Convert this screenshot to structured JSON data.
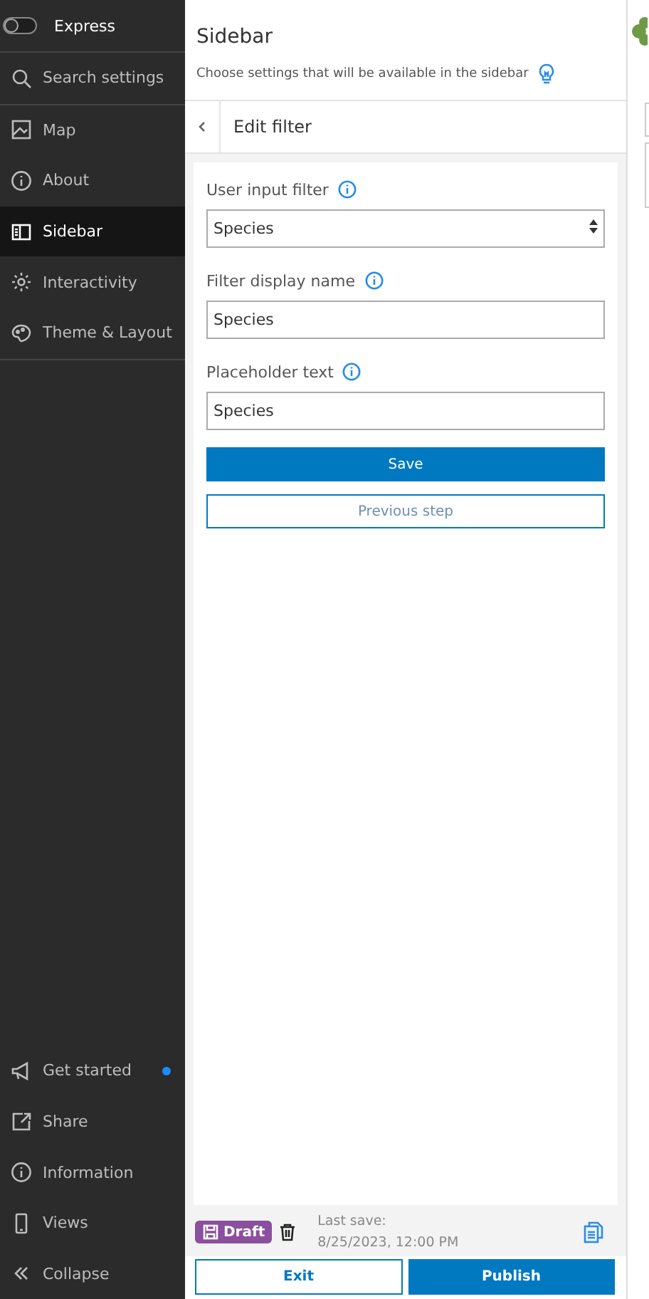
{
  "nav": {
    "toggle": {
      "label": "Express",
      "on": false
    },
    "items": [
      {
        "label": "Search settings",
        "selected": false
      },
      {
        "label": "Map",
        "selected": false
      },
      {
        "label": "About",
        "selected": false
      },
      {
        "label": "Sidebar",
        "selected": true
      },
      {
        "label": "Interactivity",
        "selected": false
      },
      {
        "label": "Theme & Layout",
        "selected": false
      }
    ],
    "bottom_items": [
      {
        "label": "Get started",
        "notification": true
      },
      {
        "label": "Share",
        "notification": false
      },
      {
        "label": "Information",
        "notification": false
      },
      {
        "label": "Views",
        "notification": false
      },
      {
        "label": "Collapse",
        "notification": false
      }
    ]
  },
  "panel": {
    "title": "Sidebar",
    "description": "Choose settings that will be available in the sidebar",
    "subheader": "Edit filter",
    "fields": [
      {
        "kind": "select",
        "label": "User input filter",
        "value": "Species"
      },
      {
        "kind": "text",
        "label": "Filter display name",
        "value": "Species"
      },
      {
        "kind": "text",
        "label": "Placeholder text",
        "value": "Species"
      }
    ],
    "buttons": [
      {
        "label": "Save",
        "kind": "primary"
      },
      {
        "label": "Previous step",
        "kind": "secondary"
      }
    ]
  },
  "footer": {
    "badge": "Draft",
    "last_save_label": "Last save:",
    "last_save_time": "8/25/2023, 12:00 PM",
    "buttons": [
      {
        "label": "Exit",
        "kind": "secondary"
      },
      {
        "label": "Publish",
        "kind": "primary"
      }
    ]
  }
}
